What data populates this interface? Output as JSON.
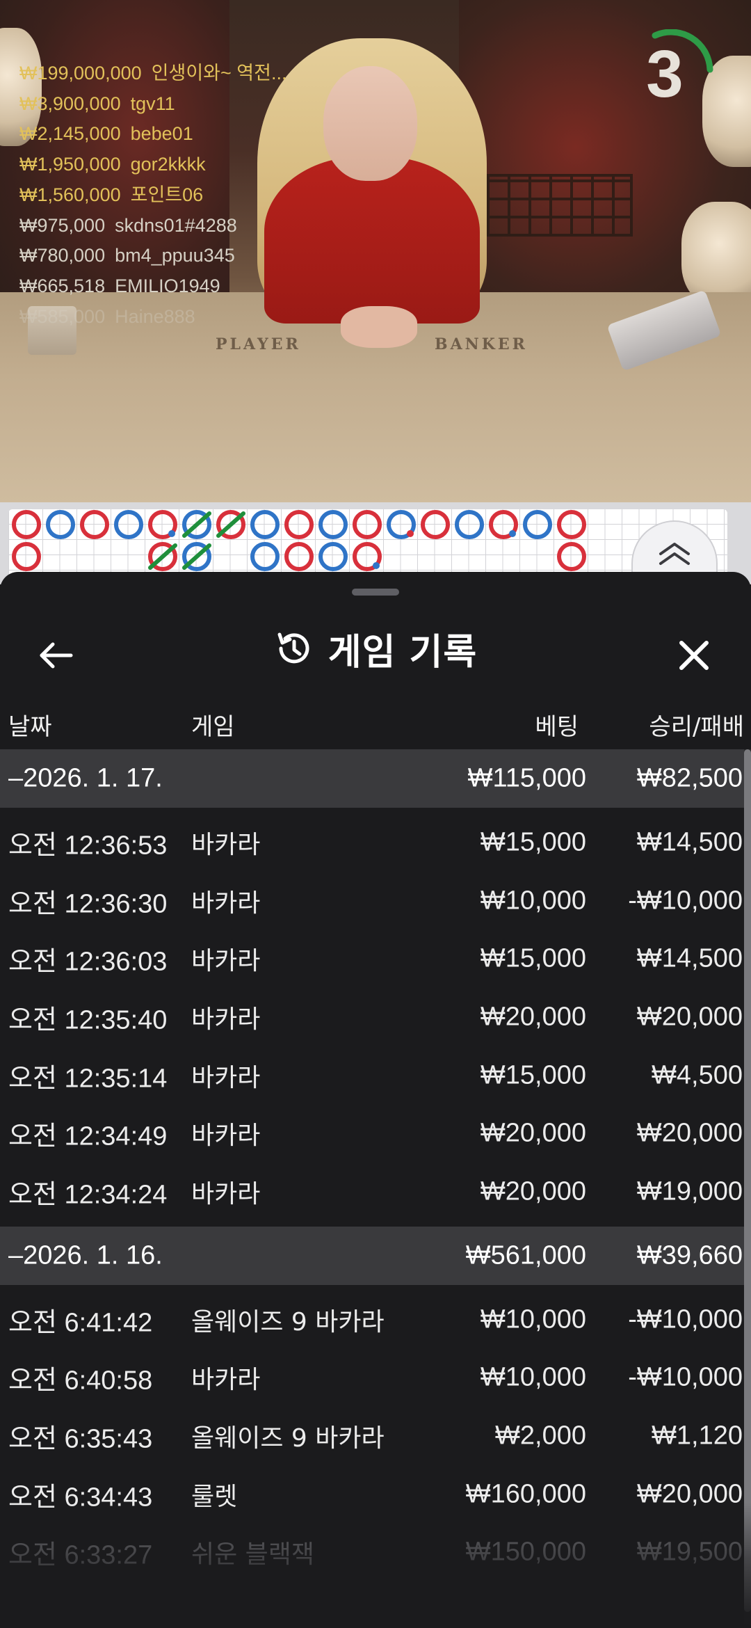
{
  "live": {
    "countdown": "3",
    "winners": [
      {
        "amount": "₩199,000,000",
        "name": "인생이와~ 역전..."
      },
      {
        "amount": "₩3,900,000",
        "name": "tgv11"
      },
      {
        "amount": "₩2,145,000",
        "name": "bebe01"
      },
      {
        "amount": "₩1,950,000",
        "name": "gor2kkkk"
      },
      {
        "amount": "₩1,560,000",
        "name": "포인트06"
      },
      {
        "amount": "₩975,000",
        "name": "skdns01#4288"
      },
      {
        "amount": "₩780,000",
        "name": "bm4_ppuu345"
      },
      {
        "amount": "₩665,518",
        "name": "EMILIO1949"
      },
      {
        "amount": "₩585,000",
        "name": "Haine888"
      }
    ],
    "table_labels": {
      "player": "PLAYER",
      "banker": "BANKER"
    },
    "colors": {
      "winner_gold": "#e2c15a",
      "countdown_ring": "#2e9b47"
    }
  },
  "roadmap": {
    "columns": [
      [
        "red",
        "red"
      ],
      [
        "blue"
      ],
      [
        "red"
      ],
      [
        "blue"
      ],
      [
        "red-pair",
        "red-tie"
      ],
      [
        "blue-tie",
        "blue-tie"
      ],
      [
        "red-tie"
      ],
      [
        "blue",
        "blue"
      ],
      [
        "red",
        "red"
      ],
      [
        "blue",
        "blue"
      ],
      [
        "red",
        "red-pair"
      ],
      [
        "blue-pair"
      ],
      [
        "red"
      ],
      [
        "blue"
      ],
      [
        "red-pair"
      ],
      [
        "blue"
      ],
      [
        "red",
        "red"
      ]
    ],
    "colors": {
      "red": "#d8303b",
      "blue": "#2f74c7",
      "tie": "#1f8f3b"
    }
  },
  "sheet": {
    "title": "게임 기록",
    "icons": {
      "back": "arrow-left-icon",
      "history": "history-icon",
      "close": "close-icon"
    },
    "columns": {
      "date": "날짜",
      "game": "게임",
      "bet": "베팅",
      "win_loss": "승리/패배"
    },
    "days": [
      {
        "date": "–2026. 1. 17.",
        "bet_total": "₩115,000",
        "wl_total": "₩82,500",
        "rows": [
          {
            "time": "오전 12:36:53",
            "game": "바카라",
            "bet": "₩15,000",
            "wl": "₩14,500"
          },
          {
            "time": "오전 12:36:30",
            "game": "바카라",
            "bet": "₩10,000",
            "wl": "-₩10,000"
          },
          {
            "time": "오전 12:36:03",
            "game": "바카라",
            "bet": "₩15,000",
            "wl": "₩14,500"
          },
          {
            "time": "오전 12:35:40",
            "game": "바카라",
            "bet": "₩20,000",
            "wl": "₩20,000"
          },
          {
            "time": "오전 12:35:14",
            "game": "바카라",
            "bet": "₩15,000",
            "wl": "₩4,500"
          },
          {
            "time": "오전 12:34:49",
            "game": "바카라",
            "bet": "₩20,000",
            "wl": "₩20,000"
          },
          {
            "time": "오전 12:34:24",
            "game": "바카라",
            "bet": "₩20,000",
            "wl": "₩19,000"
          }
        ]
      },
      {
        "date": "–2026. 1. 16.",
        "bet_total": "₩561,000",
        "wl_total": "₩39,660",
        "rows": [
          {
            "time": "오전 6:41:42",
            "game": "올웨이즈 9 바카라",
            "bet": "₩10,000",
            "wl": "-₩10,000"
          },
          {
            "time": "오전 6:40:58",
            "game": "바카라",
            "bet": "₩10,000",
            "wl": "-₩10,000"
          },
          {
            "time": "오전 6:35:43",
            "game": "올웨이즈 9 바카라",
            "bet": "₩2,000",
            "wl": "₩1,120"
          },
          {
            "time": "오전 6:34:43",
            "game": "룰렛",
            "bet": "₩160,000",
            "wl": "₩20,000"
          },
          {
            "time": "오전 6:33:27",
            "game": "쉬운 블랙잭",
            "bet": "₩150,000",
            "wl": "₩19,500"
          }
        ]
      }
    ]
  }
}
